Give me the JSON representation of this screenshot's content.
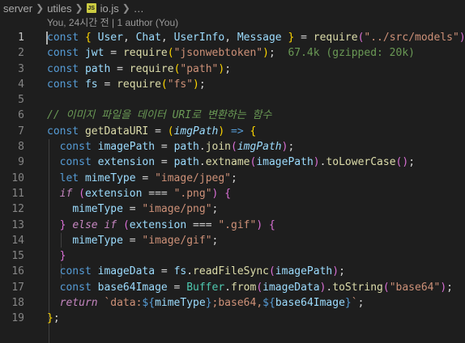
{
  "breadcrumb": {
    "parts": [
      "server",
      "utiles"
    ],
    "file_icon": "JS",
    "file": "io.js",
    "ellipsis": "…"
  },
  "codelens": "You, 24시간 전 | 1 author (You)",
  "import_cost": "67.4k (gzipped: 20k)",
  "comment": "// 이미지 파일을 데이터 URI로 변환하는 함수",
  "line_numbers": [
    "1",
    "2",
    "3",
    "4",
    "5",
    "6",
    "7",
    "8",
    "9",
    "10",
    "11",
    "12",
    "13",
    "14",
    "15",
    "16",
    "17",
    "18",
    "19"
  ],
  "colors": {
    "background": "#1e1e1e",
    "keyword": "#569cd6",
    "control": "#c586c0",
    "variable": "#9cdcfe",
    "function": "#dcdcaa",
    "string": "#ce9178",
    "type": "#4ec9b0",
    "comment": "#6a9955"
  }
}
